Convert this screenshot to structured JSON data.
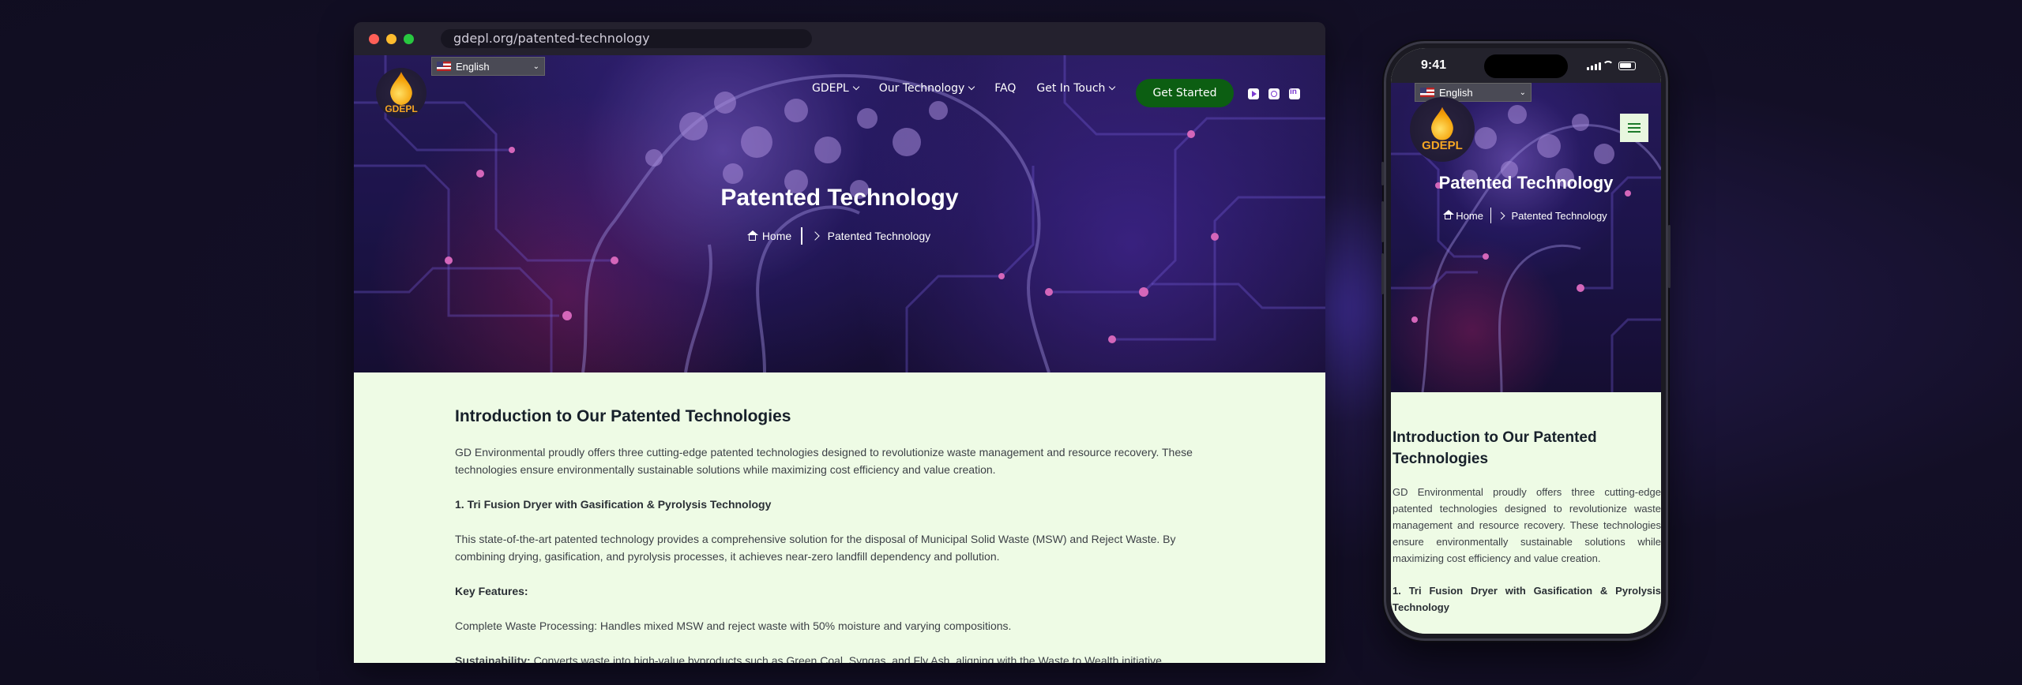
{
  "browser": {
    "url": "gdepl.org/patented-technology"
  },
  "site": {
    "language": "English",
    "logo_text": "GDEPL",
    "nav": [
      {
        "label": "GDEPL",
        "has_dropdown": true
      },
      {
        "label": "Our Technology",
        "has_dropdown": true
      },
      {
        "label": "FAQ",
        "has_dropdown": false
      },
      {
        "label": "Get In Touch",
        "has_dropdown": true
      }
    ],
    "cta_label": "Get Started",
    "socials": [
      "youtube-icon",
      "instagram-icon",
      "linkedin-icon"
    ],
    "hero_title": "Patented Technology",
    "breadcrumb": {
      "home": "Home",
      "current": "Patented Technology"
    },
    "accent_green": "#0c5e12",
    "content_bg": "#eefbe5"
  },
  "content": {
    "heading": "Introduction to Our Patented Technologies",
    "intro": "GD Environmental proudly offers three cutting-edge patented technologies designed to revolutionize waste management and resource recovery. These technologies ensure environmentally sustainable solutions while maximizing cost efficiency and value creation.",
    "tech1_title": "1. Tri Fusion Dryer with Gasification & Pyrolysis Technology",
    "tech1_desc": "This state-of-the-art patented technology provides a comprehensive solution for the disposal of Municipal Solid Waste (MSW) and Reject Waste. By combining drying, gasification, and pyrolysis processes, it achieves near-zero landfill dependency and pollution.",
    "key_features": "Key Features:",
    "feature1": "Complete Waste Processing: Handles mixed MSW and reject waste with 50% moisture and varying compositions.",
    "feature2_label": "Sustainability:",
    "feature2_text": " Converts waste into high-value byproducts such as Green Coal, Syngas, and Fly Ash, aligning with the Waste to Wealth initiative."
  },
  "phone": {
    "time": "9:41"
  }
}
